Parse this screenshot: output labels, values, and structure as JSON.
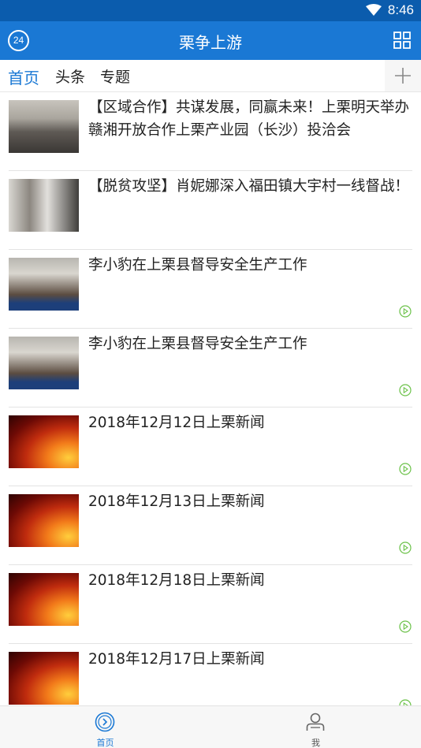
{
  "status_bar": {
    "time": "8:46",
    "wifi_icon": "wifi-icon"
  },
  "app_bar": {
    "logo_text": "24",
    "title": "栗争上游",
    "menu_icon": "grid-icon"
  },
  "tabs": [
    {
      "label": "首页",
      "active": true
    },
    {
      "label": "头条",
      "active": false
    },
    {
      "label": "专题",
      "active": false
    }
  ],
  "tab_add_icon": "plus-icon",
  "feed": [
    {
      "title": "【区域合作】共谋发展，同赢未来！上栗明天举办赣湘开放合作上栗产业园（长沙）投洽会",
      "video": false
    },
    {
      "title": "【脱贫攻坚】肖妮娜深入福田镇大宇村一线督战！",
      "video": false
    },
    {
      "title": "李小豹在上栗县督导安全生产工作",
      "video": true
    },
    {
      "title": "李小豹在上栗县督导安全生产工作",
      "video": true
    },
    {
      "title": "2018年12月12日上栗新闻",
      "video": true
    },
    {
      "title": "2018年12月13日上栗新闻",
      "video": true
    },
    {
      "title": "2018年12月18日上栗新闻",
      "video": true
    },
    {
      "title": "2018年12月17日上栗新闻",
      "video": true
    }
  ],
  "bottom_nav": [
    {
      "label": "首页",
      "icon": "home-icon",
      "active": true
    },
    {
      "label": "我",
      "icon": "user-icon",
      "active": false
    }
  ],
  "colors": {
    "status_bar": "#0b5cad",
    "app_bar": "#1a78d4",
    "accent": "#1a78d4",
    "play_icon": "#6cc24a"
  }
}
